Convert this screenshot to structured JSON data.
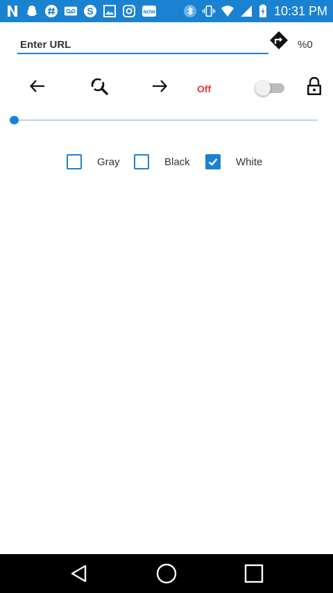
{
  "status_bar": {
    "time": "10:31 PM",
    "background": "#1b82d2",
    "notification_icons": [
      "n-app-icon",
      "snapchat-icon",
      "hashtag-icon",
      "voicemail-icon",
      "skype-icon",
      "image-icon",
      "instagram-icon",
      "now-app-icon"
    ],
    "system_icons": [
      "bluetooth-icon",
      "vibrate-icon",
      "wifi-icon",
      "signal-icon",
      "battery-charging-icon"
    ],
    "now_badge": "NOW"
  },
  "url_bar": {
    "placeholder": "Enter URL",
    "value": "",
    "percent": "%0"
  },
  "toolbar": {
    "off_label": "Off",
    "switch_on": false,
    "icons": [
      "back-arrow-icon",
      "refresh-search-icon",
      "forward-arrow-icon",
      "lock-icon"
    ]
  },
  "slider": {
    "value": 0
  },
  "color_options": [
    {
      "label": "Gray",
      "checked": false
    },
    {
      "label": "Black",
      "checked": false
    },
    {
      "label": "White",
      "checked": true
    }
  ],
  "accent_color": "#1b82d2",
  "off_color": "#e53935"
}
